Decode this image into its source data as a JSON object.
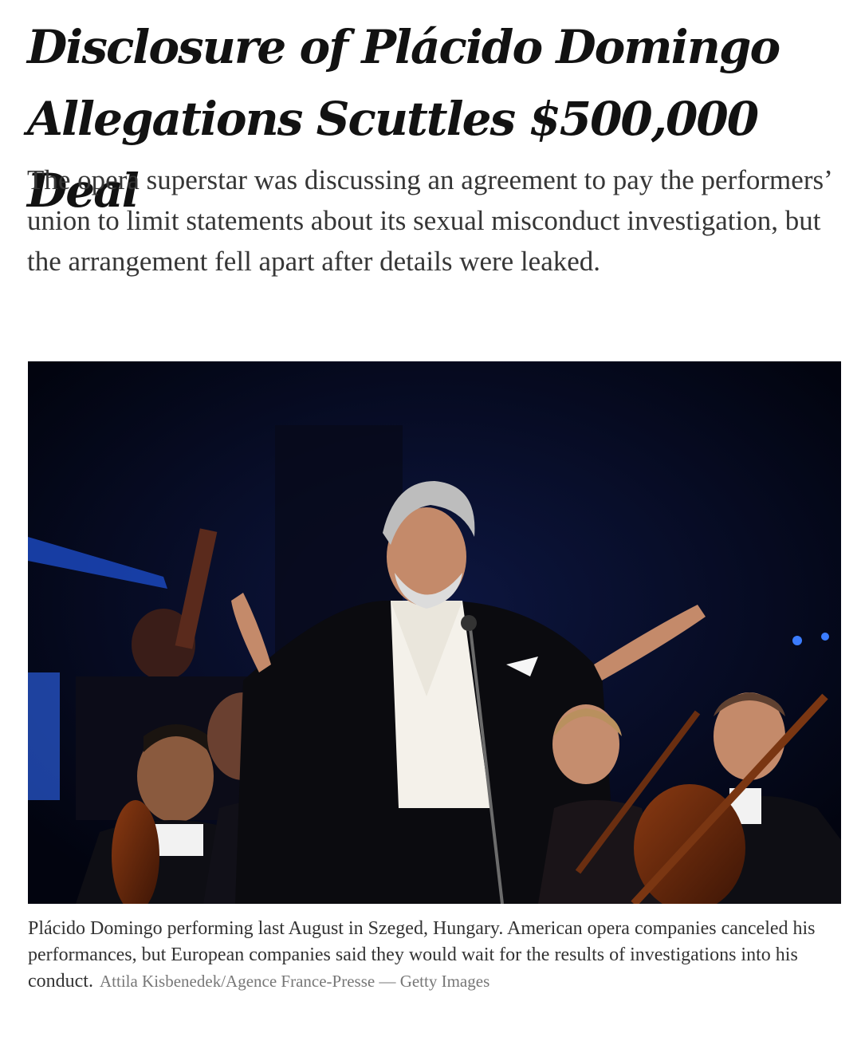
{
  "article": {
    "headline": "Disclosure of Plácido Domingo Allegations Scuttles $500,000 Deal",
    "summary": "The opera superstar was discussing an agreement to pay the performers’ union to limit statements about its sexual misconduct investigation, but the arrangement fell apart after details were leaked.",
    "caption": "Plácido Domingo performing last August in Szeged, Hungary. American opera companies canceled his performances, but European companies said they would wait for the results of investigations into his conduct.",
    "credit": "Attila Kisbenedek/Agence France-Presse — Getty Images"
  },
  "colors": {
    "headline": "#121212",
    "body_text": "#363636",
    "caption_text": "#333333",
    "credit_text": "#777777",
    "photo_background": "#04081a"
  }
}
